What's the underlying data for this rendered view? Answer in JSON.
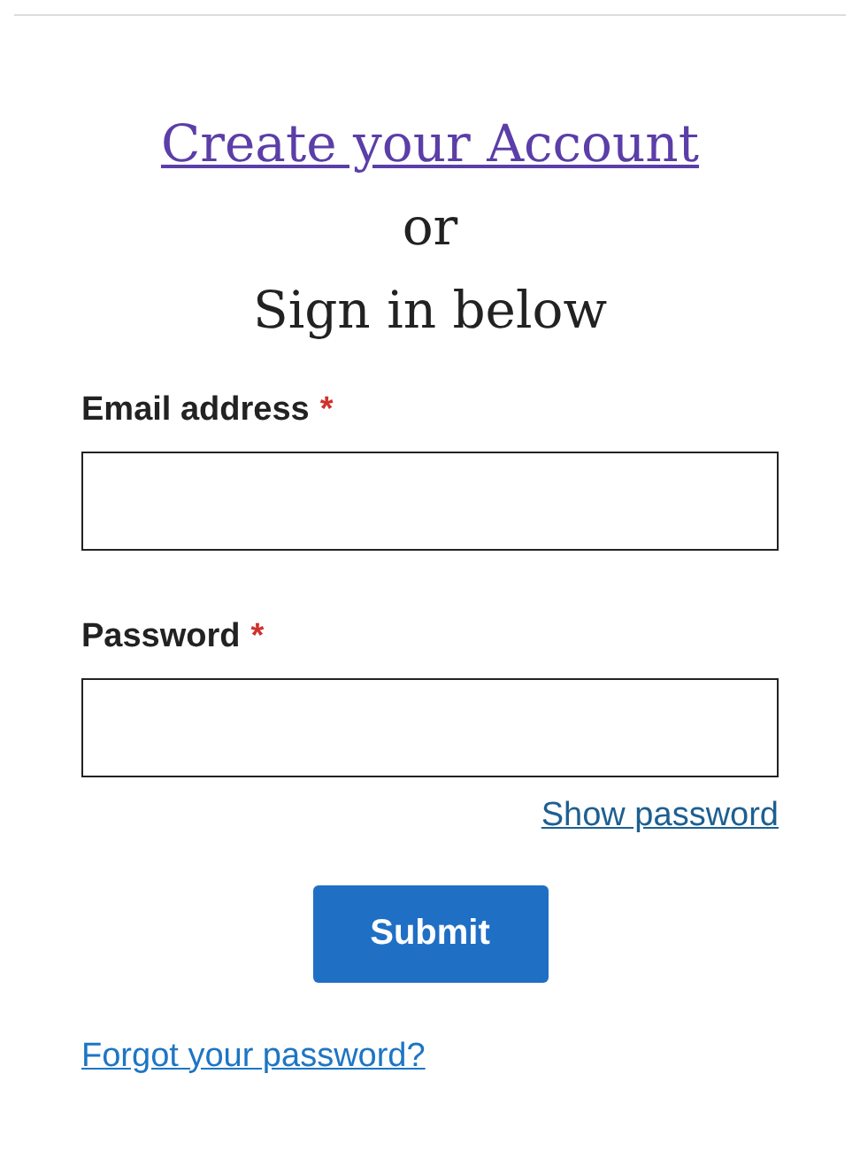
{
  "heading": {
    "link": "Create your Account",
    "or": "or",
    "subtitle": "Sign in below"
  },
  "fields": [
    {
      "label": "Email address",
      "required_mark": "*"
    },
    {
      "label": "Password",
      "required_mark": "*"
    }
  ],
  "show_password": "Show password",
  "submit": "Submit",
  "forgot": "Forgot your password?"
}
